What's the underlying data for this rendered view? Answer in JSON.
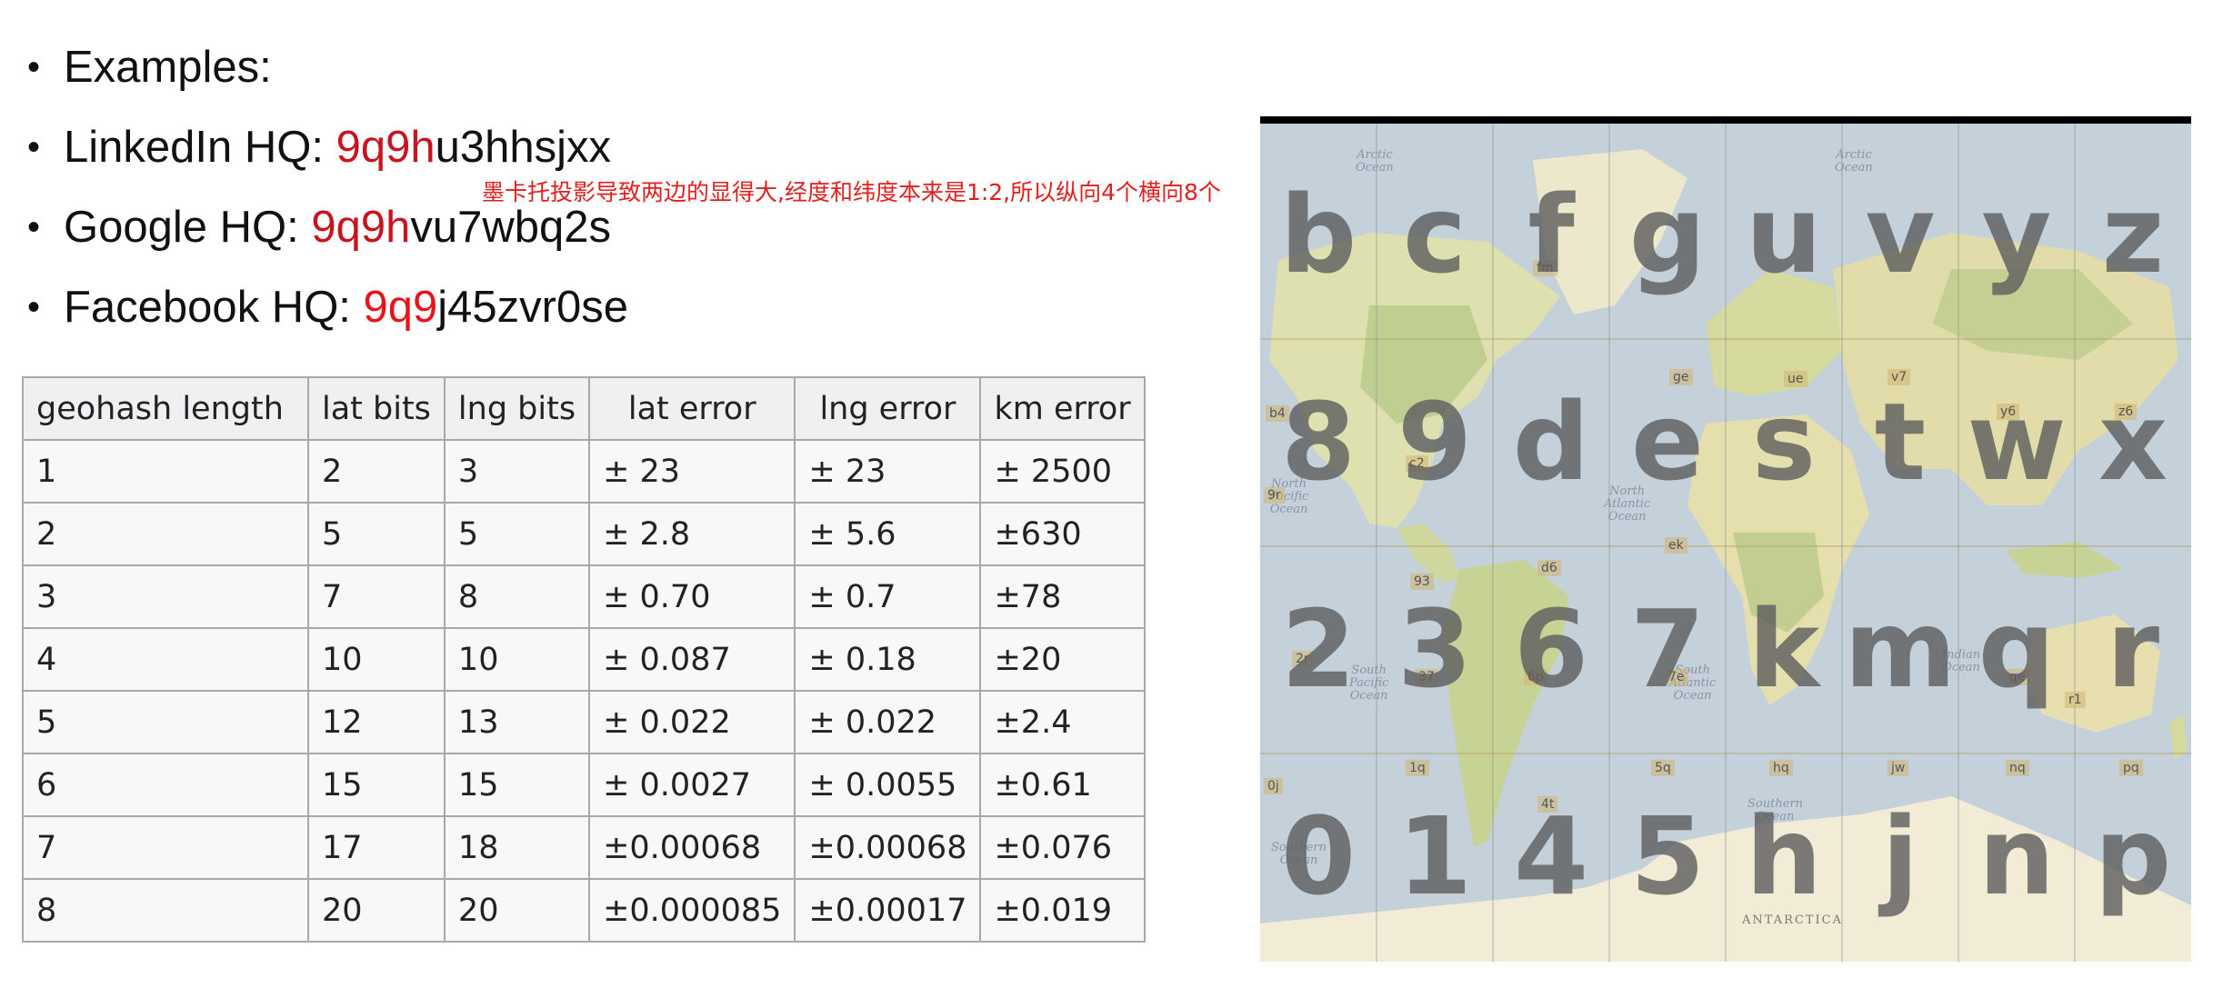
{
  "bullets": [
    {
      "plain": "Examples:",
      "hl": "",
      "rest": ""
    },
    {
      "plain": "LinkedIn HQ: ",
      "hl": "9q9h",
      "rest": "u3hhsjxx"
    },
    {
      "plain": "Google HQ: ",
      "hl": "9q9h",
      "rest": "vu7wbq2s"
    },
    {
      "plain": "Facebook HQ: ",
      "hl": "9q9",
      "rest": "j45zvr0se"
    }
  ],
  "annotation": "墨卡托投影导致两边的显得大,经度和纬度本来是1:2,所以纵向4个横向8个",
  "table": {
    "headers": [
      "geohash length",
      "lat bits",
      "lng bits",
      "lat error",
      "lng error",
      "km error"
    ],
    "rows": [
      [
        "1",
        "2",
        "3",
        "± 23",
        "± 23",
        "± 2500"
      ],
      [
        "2",
        "5",
        "5",
        "± 2.8",
        "± 5.6",
        "±630"
      ],
      [
        "3",
        "7",
        "8",
        "± 0.70",
        "± 0.7",
        "±78"
      ],
      [
        "4",
        "10",
        "10",
        "± 0.087",
        "± 0.18",
        "±20"
      ],
      [
        "5",
        "12",
        "13",
        "± 0.022",
        "± 0.022",
        "±2.4"
      ],
      [
        "6",
        "15",
        "15",
        "± 0.0027",
        "± 0.0055",
        "±0.61"
      ],
      [
        "7",
        "17",
        "18",
        "±0.00068",
        "±0.00068",
        "±0.076"
      ],
      [
        "8",
        "20",
        "20",
        "±0.000085",
        "±0.00017",
        "±0.019"
      ]
    ]
  },
  "map": {
    "grid_rows": [
      [
        "b",
        "c",
        "f",
        "g",
        "u",
        "v",
        "y",
        "z"
      ],
      [
        "8",
        "9",
        "d",
        "e",
        "s",
        "t",
        "w",
        "x"
      ],
      [
        "2",
        "3",
        "6",
        "7",
        "k",
        "m",
        "q",
        "r"
      ],
      [
        "0",
        "1",
        "4",
        "5",
        "h",
        "j",
        "n",
        "p"
      ]
    ],
    "ocean_labels": [
      "Arctic\nOcean",
      "Arctic\nOcean",
      "North\nPacific\nOcean",
      "North\nAtlantic\nOcean",
      "South\nPacific\nOcean",
      "South\nAtlantic\nOcean",
      "Indian\nOcean",
      "Southern\nOcean",
      "Southern\nOcean"
    ],
    "antarctica": "ANTARCTICA",
    "sub_cells": [
      "fm",
      "ge",
      "ue",
      "v7",
      "b4",
      "c2",
      "y6",
      "z6",
      "9r",
      "d6",
      "ek",
      "93",
      "2r",
      "37",
      "6p",
      "7e",
      "qe",
      "r1",
      "0j",
      "1q",
      "4t",
      "5q",
      "hq",
      "jw",
      "nq",
      "pq"
    ],
    "colors": {
      "ocean": "#c4d0da",
      "land": "#e8e2bc",
      "vegetation": "#b9c98a",
      "letter": "#5f5f5f"
    }
  }
}
